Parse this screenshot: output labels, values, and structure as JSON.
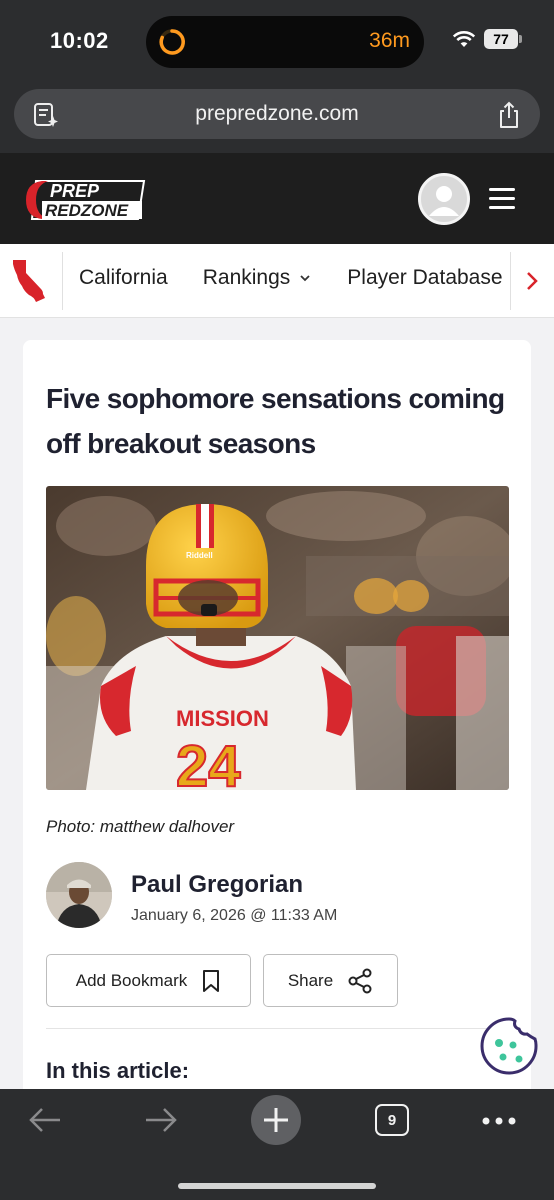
{
  "status_bar": {
    "time": "10:02",
    "timer": "36m",
    "battery": "77",
    "icons": [
      "timer-ring-icon",
      "wifi-icon",
      "battery-icon"
    ]
  },
  "browser": {
    "url": "prepredzone.com",
    "left_icon": "page-summary-icon",
    "right_icon": "share-icon"
  },
  "site": {
    "logo_line1": "PREP",
    "logo_line2": "REDZONE",
    "brand_color": "#d8232a"
  },
  "nav": {
    "state_icon": "california-map-icon",
    "items": [
      "California",
      "Rankings",
      "Player Database"
    ],
    "rankings_icon": "chevron-down-icon",
    "next_icon": "chevron-right-icon"
  },
  "article": {
    "title": "Five sophomore sensations coming off breakout seasons",
    "photo_jersey_name": "MISSION",
    "photo_jersey_number": "24",
    "photo_helmet_brand": "Riddell",
    "caption": "Photo: matthew dalhover",
    "author_name": "Paul Gregorian",
    "date": "January 6, 2026 @ 11:33 AM",
    "bookmark_label": "Add Bookmark",
    "share_label": "Share",
    "section_heading": "In this article:"
  },
  "toolbar": {
    "tab_count": "9",
    "icons": [
      "back-arrow-icon",
      "forward-arrow-icon",
      "plus-icon",
      "tabs-icon",
      "more-icon"
    ]
  }
}
